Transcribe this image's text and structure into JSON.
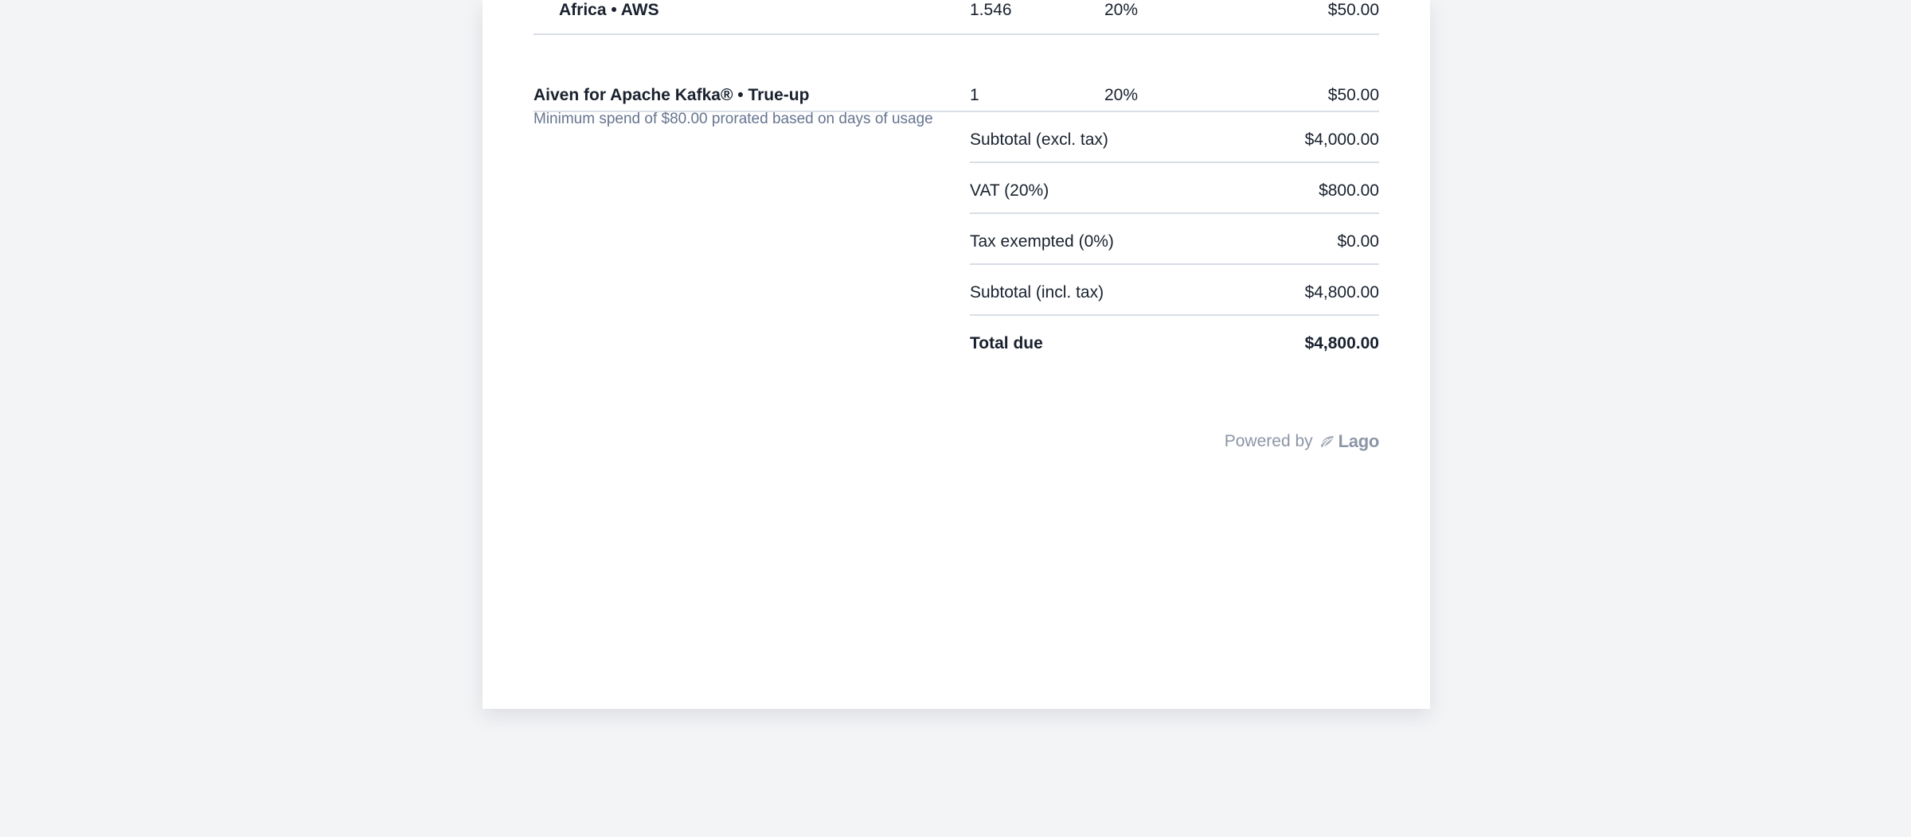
{
  "line_items": [
    {
      "description": "Africa • AWS",
      "units": "1.546",
      "tax_rate": "20%",
      "amount": "$50.00"
    },
    {
      "description": "Aiven for Apache Kafka® • True-up",
      "subtext": "Minimum spend of $80.00 prorated based on days of usage",
      "units": "1",
      "tax_rate": "20%",
      "amount": "$50.00"
    }
  ],
  "totals": [
    {
      "label": "Subtotal (excl. tax)",
      "value": "$4,000.00"
    },
    {
      "label": "VAT (20%)",
      "value": "$800.00"
    },
    {
      "label": "Tax exempted (0%)",
      "value": "$0.00"
    },
    {
      "label": "Subtotal (incl. tax)",
      "value": "$4,800.00"
    },
    {
      "label": "Total due",
      "value": "$4,800.00"
    }
  ],
  "footer": {
    "powered_by": "Powered by",
    "brand": "Lago",
    "brand_icon": "lago-logo-icon"
  },
  "colors": {
    "page_background": "#f3f4f6",
    "text_primary": "#19212e",
    "text_secondary": "#66758f",
    "divider": "#d9dee7",
    "footer_text": "#8c95a6"
  }
}
